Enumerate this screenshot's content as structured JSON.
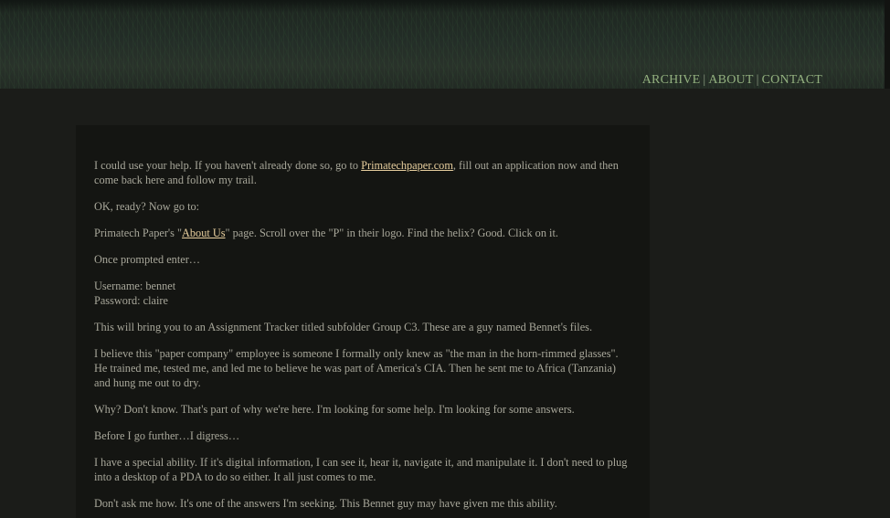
{
  "nav": {
    "archive": "ARCHIVE",
    "about": "ABOUT",
    "contact": "CONTACT",
    "separator": "|"
  },
  "post": {
    "p1_before": "I could use your help. If you haven't already done so, go to ",
    "p1_link": "Primatechpaper.com",
    "p1_after": ", fill out an application now and then come back here and follow my trail.",
    "p2": "OK, ready? Now go to:",
    "p3_before": "Primatech Paper's \"",
    "p3_link": "About Us",
    "p3_after": "\" page. Scroll over the \"P\" in their logo. Find the helix? Good. Click on it.",
    "p4": "Once prompted enter…",
    "username": "Username: bennet",
    "password": "Password: claire",
    "p6": "This will bring you to an Assignment Tracker titled subfolder Group C3. These are a guy named Bennet's files.",
    "p7": "I believe this \"paper company\" employee is someone I formally only knew as \"the man in the horn-rimmed glasses\". He trained me, tested me, and led me to believe he was part of America's CIA. Then he sent me to Africa (Tanzania) and hung me out to dry.",
    "p8": "Why? Don't know. That's part of why we're here. I'm looking for some help. I'm looking for some answers.",
    "p9": "Before I go further…I digress…",
    "p10": "I have a special ability. If it's digital information, I can see it, hear it, navigate it, and manipulate it. I don't need to plug into a desktop of a PDA to do so either. It all just comes to me.",
    "p11": "Don't ask me how. It's one of the answers I'm seeking. This Bennet guy may have given me this ability."
  },
  "colors": {
    "background": "#1b1c19",
    "content_bg": "#141512",
    "text": "#a8a79a",
    "link": "#e8cf9e",
    "nav": "#93b07f"
  }
}
